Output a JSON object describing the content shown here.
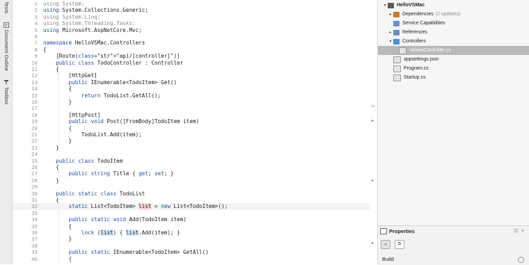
{
  "left_tabs": [
    {
      "label": "Tests",
      "icon": "test-tube-icon"
    },
    {
      "label": "Document Outline",
      "icon": "outline-icon"
    },
    {
      "label": "Toolbox",
      "icon": "hammer-icon"
    }
  ],
  "editor": {
    "lines": [
      {
        "n": "1",
        "text": "using System;"
      },
      {
        "n": "2",
        "text": "using System.Collections.Generic;"
      },
      {
        "n": "3",
        "text": "using System.Linq;"
      },
      {
        "n": "4",
        "text": "using System.Threading.Tasks;"
      },
      {
        "n": "5",
        "text": "using Microsoft.AspNetCore.Mvc;"
      },
      {
        "n": "6",
        "text": ""
      },
      {
        "n": "7",
        "text": "namespace HelloVSMac.Controllers"
      },
      {
        "n": "8",
        "text": "{"
      },
      {
        "n": "9",
        "text": "    [Route(\"api/[controller]\")]"
      },
      {
        "n": "10",
        "text": "    public class TodoController : Controller"
      },
      {
        "n": "11",
        "text": "    {"
      },
      {
        "n": "12",
        "text": "        [HttpGet]"
      },
      {
        "n": "13",
        "text": "        public IEnumerable<TodoItem> Get()"
      },
      {
        "n": "14",
        "text": "        {"
      },
      {
        "n": "15",
        "text": "            return TodoList.GetAll();"
      },
      {
        "n": "16",
        "text": "        }"
      },
      {
        "n": "17",
        "text": ""
      },
      {
        "n": "18",
        "text": "        [HttpPost]"
      },
      {
        "n": "19",
        "text": "        public void Post([FromBody]TodoItem item)"
      },
      {
        "n": "20",
        "text": "        {"
      },
      {
        "n": "21",
        "text": "            TodoList.Add(item);"
      },
      {
        "n": "22",
        "text": "        }"
      },
      {
        "n": "23",
        "text": "    }"
      },
      {
        "n": "24",
        "text": ""
      },
      {
        "n": "25",
        "text": "    public class TodoItem"
      },
      {
        "n": "26",
        "text": "    {"
      },
      {
        "n": "27",
        "text": "        public string Title { get; set; }"
      },
      {
        "n": "28",
        "text": "    }"
      },
      {
        "n": "29",
        "text": ""
      },
      {
        "n": "30",
        "text": "    public static class TodoList"
      },
      {
        "n": "31",
        "text": "    {"
      },
      {
        "n": "32",
        "text": "        static List<TodoItem> list = new List<TodoItem>();"
      },
      {
        "n": "33",
        "text": ""
      },
      {
        "n": "34",
        "text": "        public static void Add(TodoItem item)"
      },
      {
        "n": "35",
        "text": "        {"
      },
      {
        "n": "36",
        "text": "            lock (list) { list.Add(item); }"
      },
      {
        "n": "37",
        "text": "        }"
      },
      {
        "n": "38",
        "text": ""
      },
      {
        "n": "39",
        "text": "        public static IEnumerable<TodoItem> GetAll()"
      },
      {
        "n": "40",
        "text": "        {"
      }
    ]
  },
  "solution_tree": [
    {
      "label": "HelloVSMac",
      "extra": "",
      "icon": "project-icon",
      "chevron": "▾",
      "bold": true,
      "selected": false
    },
    {
      "label": "Dependencies",
      "extra": "(2 updates)",
      "icon": "dependencies-icon",
      "chevron": "▸",
      "bold": false,
      "selected": false
    },
    {
      "label": "Service Capabilities",
      "extra": "",
      "icon": "service-icon",
      "chevron": "",
      "bold": false,
      "selected": false
    },
    {
      "label": "References",
      "extra": "",
      "icon": "references-icon",
      "chevron": "▸",
      "bold": false,
      "selected": false
    },
    {
      "label": "Controllers",
      "extra": "",
      "icon": "folder-icon",
      "chevron": "▾",
      "bold": false,
      "selected": false
    },
    {
      "label": "ValuesController.cs",
      "extra": "",
      "icon": "csharp-file-icon",
      "chevron": "",
      "bold": false,
      "selected": true
    },
    {
      "label": "appsettings.json",
      "extra": "",
      "icon": "json-file-icon",
      "chevron": "",
      "bold": false,
      "selected": false
    },
    {
      "label": "Program.cs",
      "extra": "",
      "icon": "csharp-file-icon",
      "chevron": "",
      "bold": false,
      "selected": false
    },
    {
      "label": "Startup.cs",
      "extra": "",
      "icon": "csharp-file-icon",
      "chevron": "",
      "bold": false,
      "selected": false
    }
  ],
  "properties": {
    "title": "Properties",
    "section": "Build"
  },
  "colors": {
    "keyword": "#1f4fa0",
    "string": "#c0392b",
    "selection": "#b9b9b9",
    "folder": "#4a90d9"
  }
}
